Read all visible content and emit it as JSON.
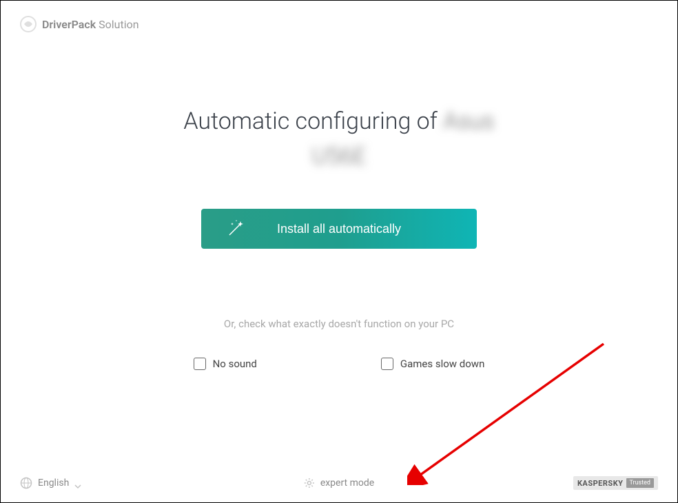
{
  "brand": {
    "name_bold": "DriverPack",
    "name_light": "Solution"
  },
  "main": {
    "title_prefix": "Automatic configuring of ",
    "device_name_line1": "Asus",
    "device_name_line2": "U56E",
    "install_button_label": "Install all automatically",
    "hint_text": "Or, check what exactly doesn't function on your PC",
    "checkboxes": [
      {
        "label": "No sound"
      },
      {
        "label": "Games slow down"
      }
    ]
  },
  "footer": {
    "language_label": "English",
    "expert_mode_label": "expert mode",
    "badge_brand": "KASPERSKY",
    "badge_text": "Trusted"
  }
}
